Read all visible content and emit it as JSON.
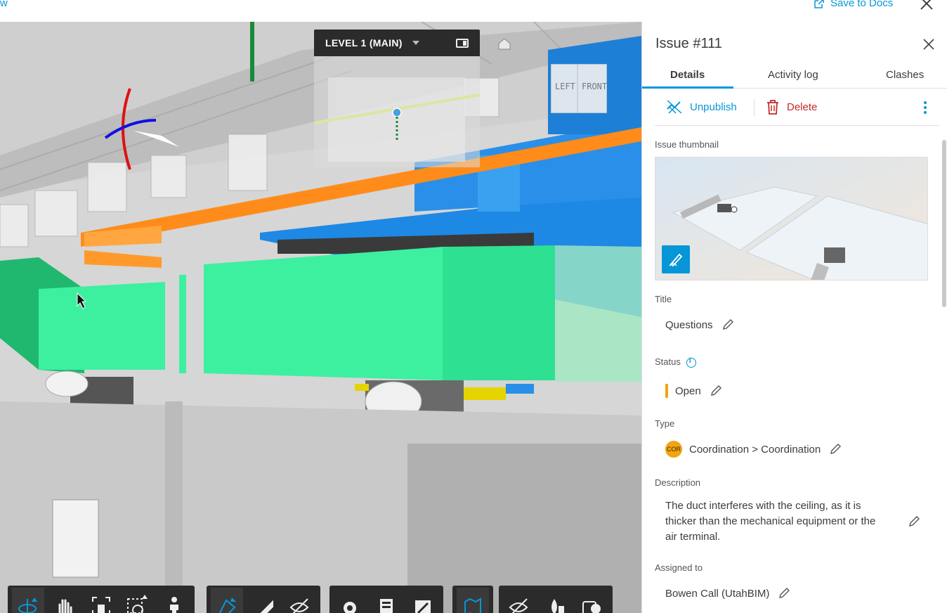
{
  "topbar": {
    "left_fragment": "w",
    "save_to_docs": "Save to Docs"
  },
  "viewer": {
    "minimap_level": "LEVEL 1 (MAIN)",
    "viewcube_left": "LEFT",
    "viewcube_front": "FRONT"
  },
  "toolbar": {
    "groups": [
      [
        "orbit-icon",
        "pan-icon",
        "fit-to-view-icon",
        "zoom-window-icon",
        "first-person-icon"
      ],
      [
        "section-analysis-icon",
        "measure-icon",
        "hide-issues-icon"
      ],
      [
        "settings-icon",
        "model-browser-icon",
        "fullscreen-icon"
      ],
      [
        "map-icon"
      ],
      [
        "hide-objects-icon",
        "isolate-properties-icon",
        "clash-filter-icon"
      ]
    ]
  },
  "panel": {
    "issue_title": "Issue #111",
    "tabs": [
      "Details",
      "Activity log",
      "Clashes"
    ],
    "actions": {
      "unpublish": "Unpublish",
      "delete": "Delete"
    },
    "thumbnail_label": "Issue thumbnail",
    "title_label": "Title",
    "title_value": "Questions",
    "status_label": "Status",
    "status_value": "Open",
    "status_color": "#f2a413",
    "type_label": "Type",
    "type_badge": "COR",
    "type_value": "Coordination > Coordination",
    "description_label": "Description",
    "description_value": "The duct interferes with the ceiling, as it is thicker than the mechanical equipment or the air terminal.",
    "assigned_label": "Assigned to",
    "assigned_value": "Bowen Call (UtahBIM)"
  },
  "colors": {
    "accent": "#0696d7",
    "delete": "#c32a2a",
    "duct_green": "#3df0a0",
    "pipe_orange": "#ff8c1a",
    "duct_blue": "#1e88e5"
  }
}
